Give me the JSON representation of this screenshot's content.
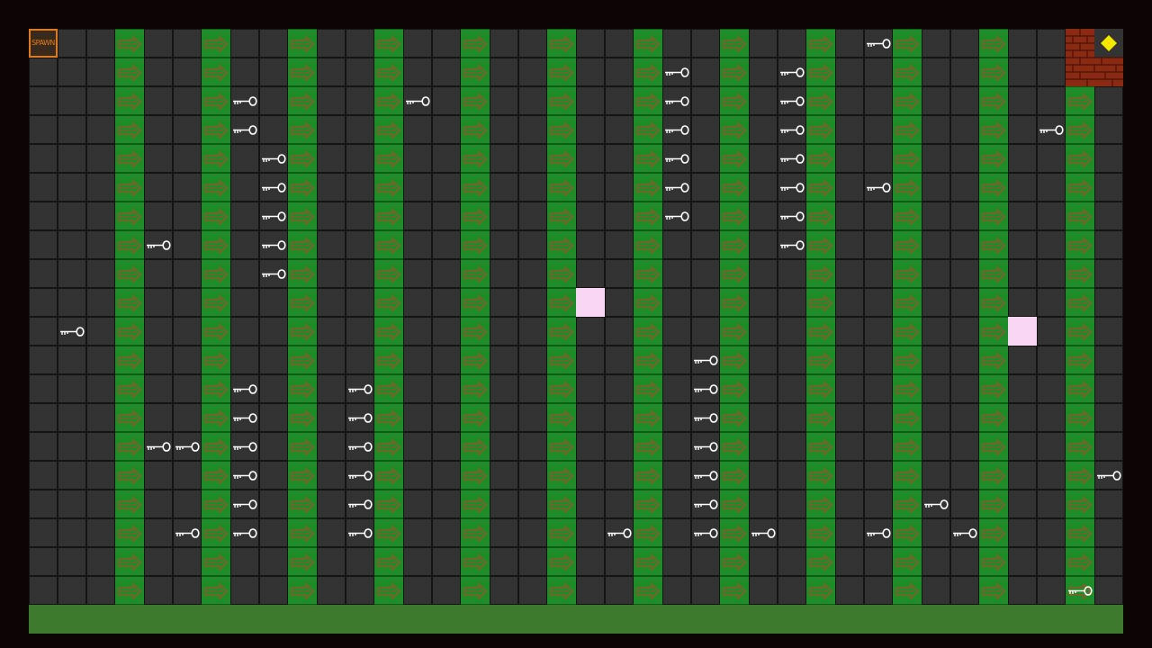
{
  "game": {
    "spawn_label": "SPAWN",
    "colors": {
      "floor": "#333333",
      "conveyor": "#1f8c2a",
      "arrow": "#8a5a2b",
      "key": "#ffffff",
      "pad": "#f9d6f4",
      "ground": "#3d7a2e",
      "brick": "#8b2a12",
      "gem": "#f5e600",
      "spawn": "#e07a1f"
    },
    "grid": {
      "cols": 38,
      "rows": 20
    },
    "conveyor_cols": [
      3,
      6,
      9,
      12,
      15,
      18,
      21,
      24,
      27,
      30,
      33,
      36
    ],
    "conveyor_direction": "right",
    "keys": [
      [
        29,
        0
      ],
      [
        22,
        1
      ],
      [
        26,
        1
      ],
      [
        7,
        2
      ],
      [
        13,
        2
      ],
      [
        22,
        2
      ],
      [
        26,
        2
      ],
      [
        7,
        3
      ],
      [
        22,
        3
      ],
      [
        26,
        3
      ],
      [
        35,
        3
      ],
      [
        8,
        4
      ],
      [
        22,
        4
      ],
      [
        26,
        4
      ],
      [
        8,
        5
      ],
      [
        22,
        5
      ],
      [
        26,
        5
      ],
      [
        29,
        5
      ],
      [
        8,
        6
      ],
      [
        22,
        6
      ],
      [
        26,
        6
      ],
      [
        4,
        7
      ],
      [
        8,
        7
      ],
      [
        26,
        7
      ],
      [
        8,
        8
      ],
      [
        1,
        10
      ],
      [
        23,
        11
      ],
      [
        7,
        12
      ],
      [
        11,
        12
      ],
      [
        23,
        12
      ],
      [
        7,
        13
      ],
      [
        11,
        13
      ],
      [
        23,
        13
      ],
      [
        4,
        14
      ],
      [
        5,
        14
      ],
      [
        7,
        14
      ],
      [
        11,
        14
      ],
      [
        23,
        14
      ],
      [
        7,
        15
      ],
      [
        11,
        15
      ],
      [
        23,
        15
      ],
      [
        37,
        15
      ],
      [
        7,
        16
      ],
      [
        11,
        16
      ],
      [
        23,
        16
      ],
      [
        31,
        16
      ],
      [
        5,
        17
      ],
      [
        7,
        17
      ],
      [
        11,
        17
      ],
      [
        20,
        17
      ],
      [
        23,
        17
      ],
      [
        25,
        17
      ],
      [
        29,
        17
      ],
      [
        32,
        17
      ],
      [
        36,
        19
      ]
    ],
    "pads": [
      [
        19,
        9
      ],
      [
        34,
        10
      ]
    ],
    "goal_icon": "gem-icon"
  }
}
